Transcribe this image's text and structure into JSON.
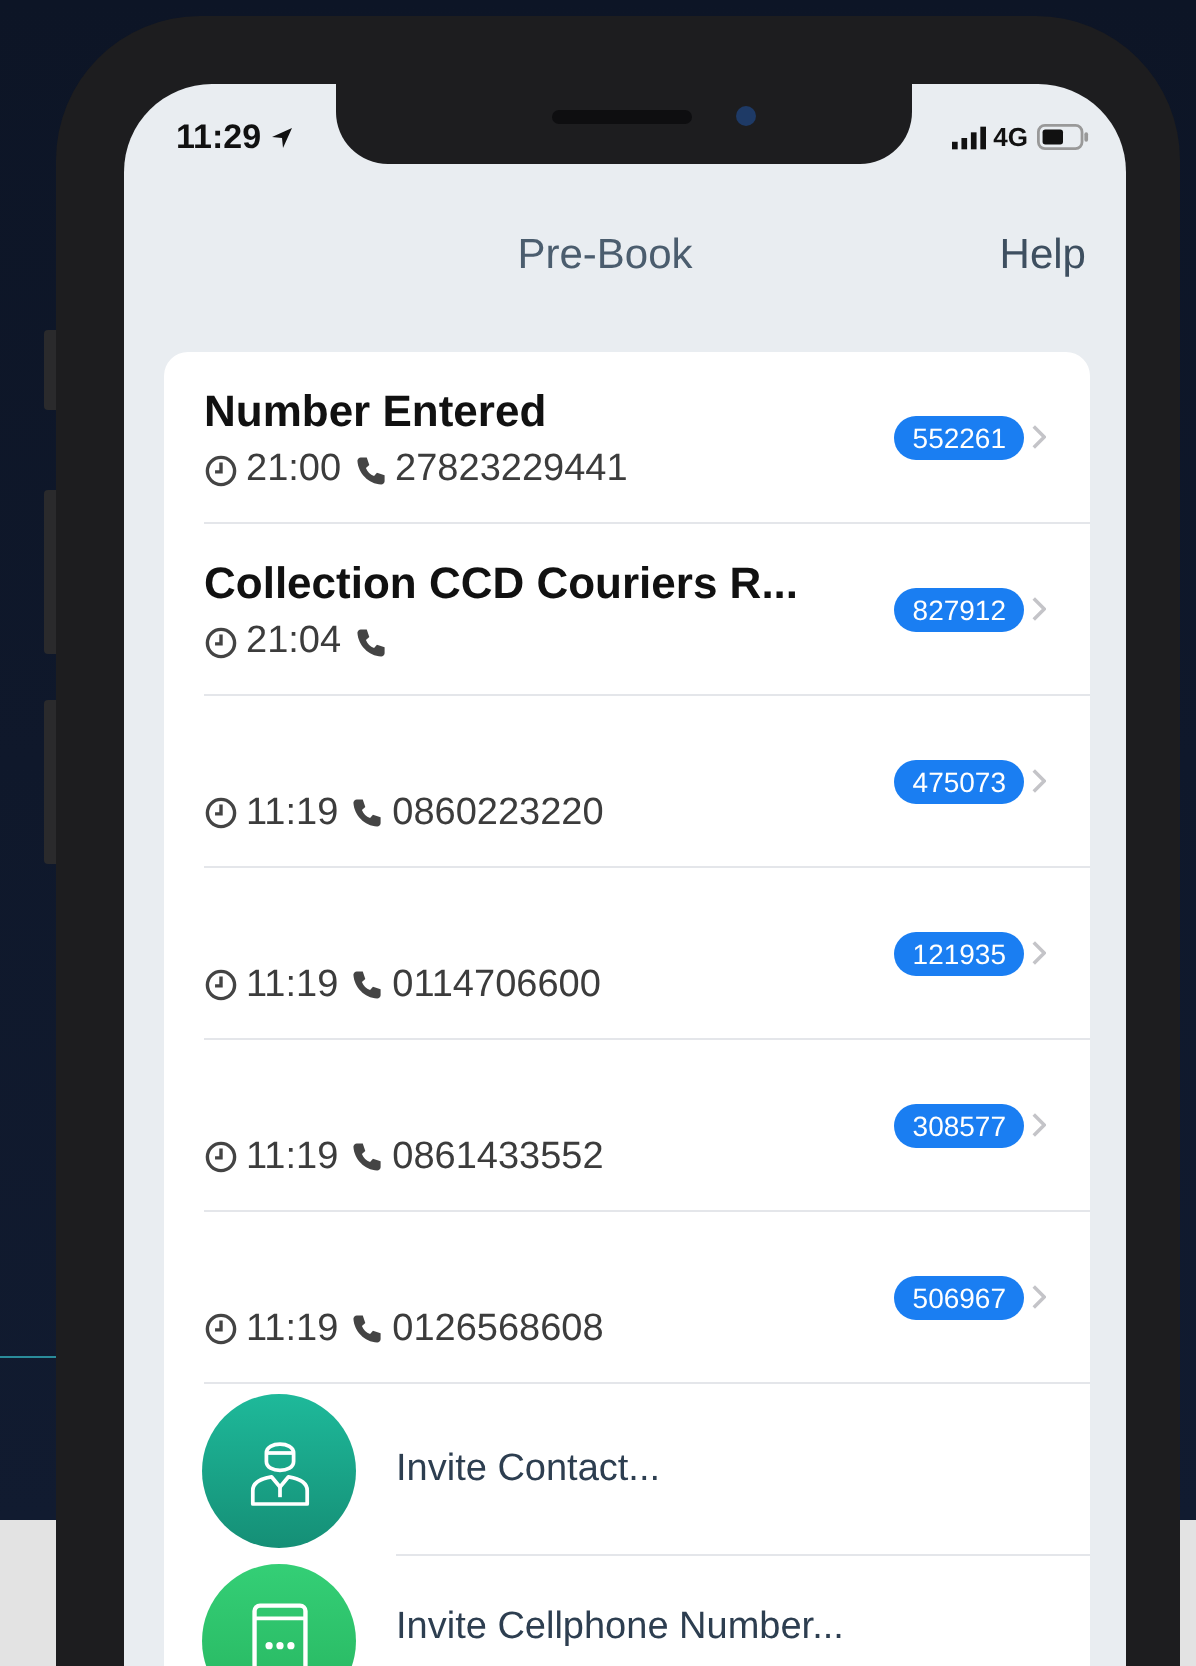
{
  "status_bar": {
    "time": "11:29",
    "network": "4G"
  },
  "nav": {
    "title": "Pre-Book",
    "action": "Help"
  },
  "bookings": [
    {
      "title": "Number Entered",
      "time": "21:00",
      "phone": "27823229441",
      "reference": "552261"
    },
    {
      "title": "Collection CCD Couriers  R...",
      "time": "21:04",
      "reference": "827912"
    },
    {
      "time": "11:19",
      "phone": "0860223220",
      "reference": "475073"
    },
    {
      "time": "11:19",
      "phone": "0114706600",
      "reference": "121935"
    },
    {
      "time": "11:19",
      "phone": "0861433552",
      "reference": "308577"
    },
    {
      "time": "11:19",
      "phone": "0126568608",
      "reference": "506967"
    }
  ],
  "invites": [
    {
      "kind": "contact",
      "label": "Invite Contact..."
    },
    {
      "kind": "cellphone",
      "label": "Invite Cellphone Number..."
    }
  ]
}
